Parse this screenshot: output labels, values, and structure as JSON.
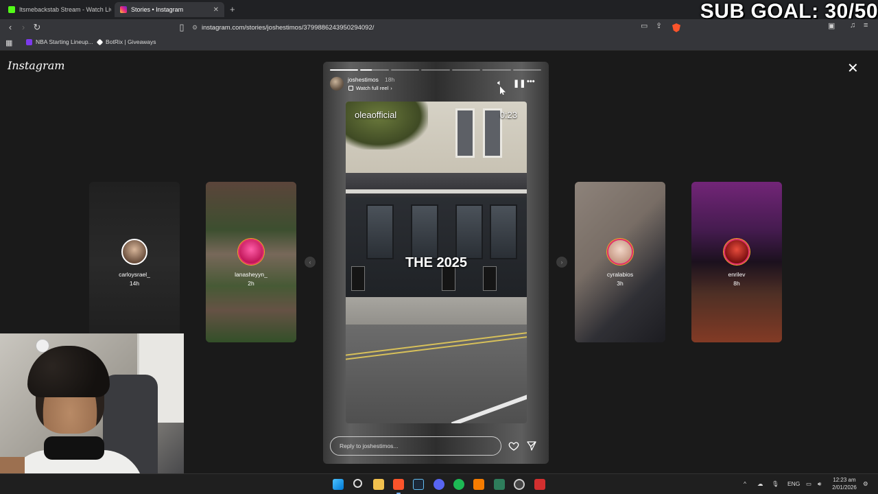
{
  "browser": {
    "tabs": [
      {
        "title": "Itsmebackstab Stream - Watch Live o",
        "favicon_color": "#53fc18"
      },
      {
        "title": "Stories • Instagram",
        "favicon_color": "#e1306c"
      }
    ],
    "new_tab": "+",
    "tab_close": "✕",
    "address": "instagram.com/stories/joshestimos/3799886243950294092/",
    "bookmarks": [
      {
        "label": "NBA Starting Lineup...",
        "icon_color": "#7c3aed"
      },
      {
        "label": "BotRix | Giveaways",
        "icon_color": "#ffffff"
      }
    ]
  },
  "overlay": {
    "sub_goal": "SUB GOAL: 30/50"
  },
  "instagram": {
    "logo": "Instagram",
    "close": "✕",
    "previews_left": [
      {
        "username": "carloysrael_",
        "time": "14h"
      },
      {
        "username": "lanasheyyn_",
        "time": "2h"
      }
    ],
    "previews_right": [
      {
        "username": "cyralabios",
        "time": "3h"
      },
      {
        "username": "enrilev",
        "time": "8h"
      }
    ],
    "prev_arrow": "‹",
    "next_arrow": "›",
    "story": {
      "username": "joshestimos",
      "time": "18h",
      "watch_full_reel": "Watch full reel",
      "reel_chevron": "›",
      "video_brand": "oleaofficial",
      "video_timer": "0:23",
      "video_caption": "THE 2025",
      "reply_placeholder": "Reply to joshestimos...",
      "progress_segments": 7,
      "progress_completed": 1,
      "progress_current_fraction": 0.4,
      "icons": [
        "sound-icon",
        "pause-icon",
        "more-icon",
        "heart-icon",
        "send-icon"
      ]
    }
  },
  "taskbar": {
    "apps": [
      "windows",
      "search",
      "file-explorer",
      "brave",
      "steam",
      "discord",
      "spotify",
      "app-orange",
      "app-green",
      "app-obs",
      "app-red"
    ],
    "tray": {
      "chevron": "^",
      "language": "ENG",
      "time": "12:23 am",
      "date": "2/01/2026"
    }
  }
}
